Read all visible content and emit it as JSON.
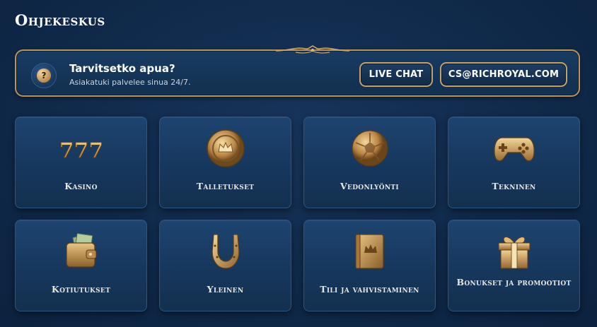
{
  "page": {
    "title": "Ohjekeskus"
  },
  "help_banner": {
    "title": "Tarvitsetko apua?",
    "subtitle": "Asiakatuki palvelee sinua 24/7.",
    "chat_label": "LIVE CHAT",
    "email_label": "CS@RICHROYAL.COM",
    "icon_glyph": "?"
  },
  "categories": [
    {
      "label": "Kasino",
      "icon": "slots-777-icon"
    },
    {
      "label": "Talletukset",
      "icon": "crown-coin-icon"
    },
    {
      "label": "Vedonlyönti",
      "icon": "soccer-ball-icon"
    },
    {
      "label": "Tekninen",
      "icon": "gamepad-icon"
    },
    {
      "label": "Kotiutukset",
      "icon": "wallet-icon"
    },
    {
      "label": "Yleinen",
      "icon": "horseshoe-icon"
    },
    {
      "label": "Tili ja vahvistaminen",
      "icon": "crown-book-icon"
    },
    {
      "label": "Bonukset ja promootiot",
      "icon": "gift-box-icon"
    }
  ],
  "colors": {
    "background": "#102a4b",
    "card": "#1a3f68",
    "gold_border": "#b8935a",
    "gold_icon": "#d9b06a"
  }
}
